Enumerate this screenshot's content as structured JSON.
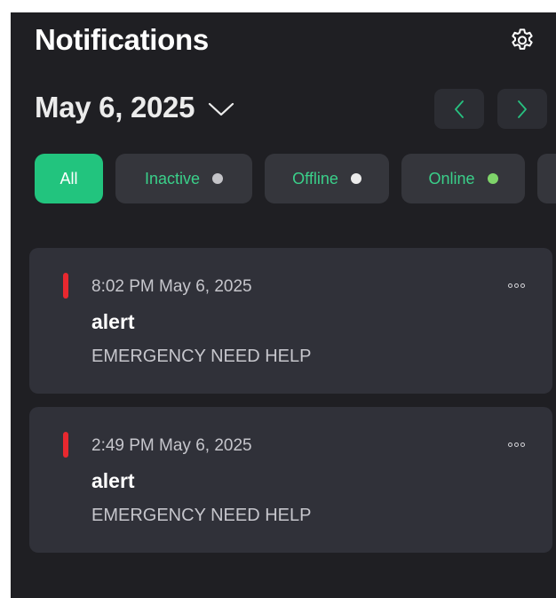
{
  "header": {
    "title": "Notifications",
    "settings_icon": "gear-icon"
  },
  "date_picker": {
    "selected_date": "May 6, 2025",
    "dropdown_icon": "chevron-down-icon",
    "prev_icon": "chevron-left-icon",
    "next_icon": "chevron-right-icon"
  },
  "filters": [
    {
      "label": "All",
      "active": true,
      "dot_color": null
    },
    {
      "label": "Inactive",
      "active": false,
      "dot_color": "#c4c4c8"
    },
    {
      "label": "Offline",
      "active": false,
      "dot_color": "#ebebeb"
    },
    {
      "label": "Online",
      "active": false,
      "dot_color": "#7fd46a"
    }
  ],
  "notifications": [
    {
      "time": "8:02 PM May 6, 2025",
      "title": "alert",
      "message": "EMERGENCY NEED HELP",
      "severity_color": "#e8282f",
      "menu_icon": "more-horizontal-icon"
    },
    {
      "time": "2:49 PM May 6, 2025",
      "title": "alert",
      "message": "EMERGENCY NEED HELP",
      "severity_color": "#e8282f",
      "menu_icon": "more-horizontal-icon"
    }
  ],
  "colors": {
    "background": "#1f1f23",
    "card": "#303139",
    "accent": "#22c47e",
    "chip_text": "#3ad08a",
    "chip_bg": "#35363c"
  }
}
